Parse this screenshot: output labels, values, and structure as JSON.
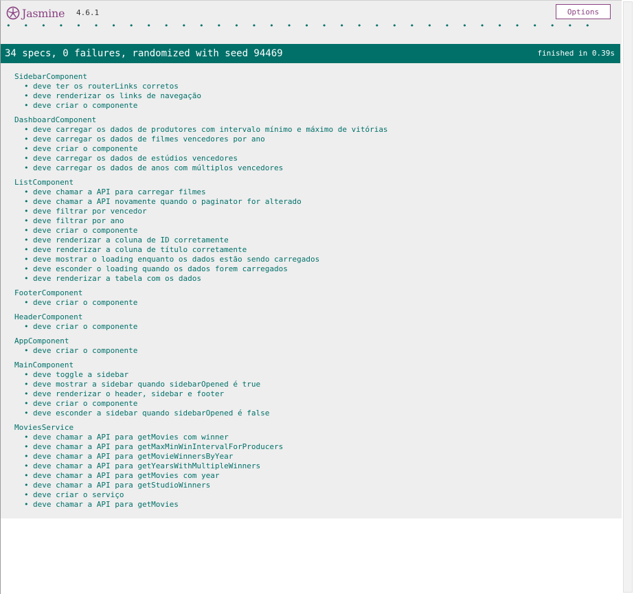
{
  "header": {
    "logo_text": "Jasmine",
    "version": "4.6.1",
    "options_label": "Options",
    "dots": "• • • • • • • • • • • • • • • • • • • • • • • • • • • • • • • • • •"
  },
  "summary": {
    "text": "34 specs, 0 failures, randomized with seed 94469",
    "duration": "finished in 0.39s"
  },
  "colors": {
    "pass": "#007069",
    "brand": "#8a4182",
    "background": "#eeeeee"
  },
  "suites": [
    {
      "name": "SidebarComponent",
      "specs": [
        "deve ter os routerLinks corretos",
        "deve renderizar os links de navegação",
        "deve criar o componente"
      ]
    },
    {
      "name": "DashboardComponent",
      "specs": [
        "deve carregar os dados de produtores com intervalo mínimo e máximo de vitórias",
        "deve carregar os dados de filmes vencedores por ano",
        "deve criar o componente",
        "deve carregar os dados de estúdios vencedores",
        "deve carregar os dados de anos com múltiplos vencedores"
      ]
    },
    {
      "name": "ListComponent",
      "specs": [
        "deve chamar a API para carregar filmes",
        "deve chamar a API novamente quando o paginator for alterado",
        "deve filtrar por vencedor",
        "deve filtrar por ano",
        "deve criar o componente",
        "deve renderizar a coluna de ID corretamente",
        "deve renderizar a coluna de título corretamente",
        "deve mostrar o loading enquanto os dados estão sendo carregados",
        "deve esconder o loading quando os dados forem carregados",
        "deve renderizar a tabela com os dados"
      ]
    },
    {
      "name": "FooterComponent",
      "specs": [
        "deve criar o componente"
      ]
    },
    {
      "name": "HeaderComponent",
      "specs": [
        "deve criar o componente"
      ]
    },
    {
      "name": "AppComponent",
      "specs": [
        "deve criar o componente"
      ]
    },
    {
      "name": "MainComponent",
      "specs": [
        "deve toggle a sidebar",
        "deve mostrar a sidebar quando sidebarOpened é true",
        "deve renderizar o header, sidebar e footer",
        "deve criar o componente",
        "deve esconder a sidebar quando sidebarOpened é false"
      ]
    },
    {
      "name": "MoviesService",
      "specs": [
        "deve chamar a API para getMovies com winner",
        "deve chamar a API para getMaxMinWinIntervalForProducers",
        "deve chamar a API para getMovieWinnersByYear",
        "deve chamar a API para getYearsWithMultipleWinners",
        "deve chamar a API para getMovies com year",
        "deve chamar a API para getStudioWinners",
        "deve criar o serviço",
        "deve chamar a API para getMovies"
      ]
    }
  ]
}
